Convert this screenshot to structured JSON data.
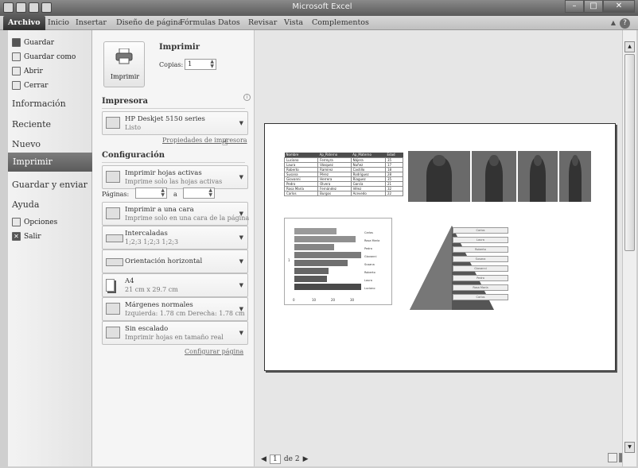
{
  "app": {
    "title": "Microsoft Excel",
    "window_buttons": {
      "minimize": "–",
      "maximize": "□",
      "close": "✕"
    }
  },
  "ribbon_tabs": [
    "Archivo",
    "Inicio",
    "Insertar",
    "Diseño de página",
    "Fórmulas",
    "Datos",
    "Revisar",
    "Vista",
    "Complementos"
  ],
  "ribbon_help": "?",
  "nav": {
    "commands": [
      "Guardar",
      "Guardar como",
      "Abrir",
      "Cerrar"
    ],
    "sections": [
      "Información",
      "Reciente",
      "Nuevo"
    ],
    "selected": "Imprimir",
    "sections2": [
      "Guardar y enviar",
      "Ayuda"
    ],
    "bottom": [
      "Opciones",
      "Salir"
    ]
  },
  "print": {
    "button_label": "Imprimir",
    "heading": "Imprimir",
    "copies_label": "Copias:",
    "copies_value": "1",
    "printer_heading": "Impresora",
    "printer_name": "HP Deskjet 5150 series",
    "printer_status": "Listo",
    "printer_props_link": "Propiedades de impresora",
    "config_heading": "Configuración",
    "pages_label": "Páginas:",
    "pages_to": "a",
    "settings": [
      {
        "line1": "Imprimir hojas activas",
        "line2": "Imprime solo las hojas activas"
      },
      {
        "line1": "Imprimir a una cara",
        "line2": "Imprime solo en una cara de la página"
      },
      {
        "line1": "Intercaladas",
        "line2": "1;2;3  1;2;3  1;2;3"
      },
      {
        "line1": "Orientación horizontal",
        "line2": ""
      },
      {
        "line1": "A4",
        "line2": "21 cm x 29.7 cm"
      },
      {
        "line1": "Márgenes normales",
        "line2": "Izquierda: 1.78 cm   Derecha: 1.78 cm"
      },
      {
        "line1": "Sin escalado",
        "line2": "Imprimir hojas en tamaño real"
      }
    ],
    "page_setup_link": "Configurar página"
  },
  "preview": {
    "table_headers": [
      "Nombre",
      "Ap_Paterno",
      "Ap_Materno",
      "Edad"
    ],
    "table_rows": [
      [
        "Luciano",
        "Ferreyra",
        "Nájera",
        "35"
      ],
      [
        "Laura",
        "Vásquez",
        "Nuñez",
        "17"
      ],
      [
        "Roberto",
        "Ramírez",
        "Castillo",
        "18"
      ],
      [
        "Susana",
        "Pérez",
        "Rodríguez",
        "28"
      ],
      [
        "Giovanni",
        "Herrera",
        "Riaguez",
        "35"
      ],
      [
        "Pedro",
        "Olvera",
        "García",
        "21"
      ],
      [
        "Rosa María",
        "Fernández",
        "Vélez",
        "32"
      ],
      [
        "Carlos",
        "Burgos",
        "Acevedo",
        "22"
      ]
    ],
    "chart_legend": [
      "Carlos",
      "Rosa María",
      "Pedro",
      "Giovanni",
      "Susana",
      "Roberto",
      "Laura",
      "Luciano"
    ],
    "chart_ticks": [
      "0",
      "10",
      "20",
      "30"
    ],
    "chart_axis_label": "1",
    "pyramid_labels": [
      "Carlos",
      "Laura",
      "Roberto",
      "Susana",
      "Giovanni",
      "Pedro",
      "Rosa María",
      "Carlos"
    ],
    "page_current": "1",
    "page_total": "de 2"
  },
  "chart_data": {
    "type": "bar",
    "categories": [
      "Luciano",
      "Laura",
      "Roberto",
      "Susana",
      "Giovanni",
      "Pedro",
      "Rosa María",
      "Carlos"
    ],
    "series": [
      {
        "values": [
          35,
          17,
          18,
          28,
          35,
          21,
          32,
          22
        ]
      }
    ],
    "xlim": [
      0,
      40
    ],
    "xticks": [
      0,
      10,
      20,
      30
    ]
  }
}
